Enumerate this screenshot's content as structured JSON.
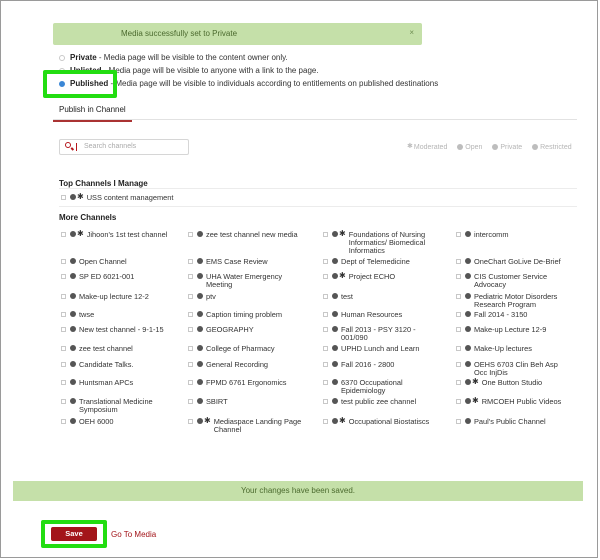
{
  "alert_top": {
    "message": "Media successfully set to Private",
    "close": "×"
  },
  "privacy": {
    "private": {
      "name": "Private",
      "desc": " - Media page will be visible to the content owner only."
    },
    "unlisted": {
      "name": "Unlisted",
      "desc": " - Media page will be visible to anyone with a link to the page."
    },
    "published": {
      "name": "Published",
      "desc": " - Media page will be visible to individuals according to entitlements on published destinations",
      "selected": true
    }
  },
  "tab": {
    "label": "Publish in Channel"
  },
  "search": {
    "placeholder": "Search channels"
  },
  "legend": {
    "moderated": "Moderated",
    "open": "Open",
    "private": "Private",
    "restricted": "Restricted"
  },
  "sections": {
    "top": "Top Channels I Manage",
    "more": "More Channels"
  },
  "top_channels": [
    {
      "label": "USS content management",
      "icons": [
        "globe",
        "star"
      ]
    }
  ],
  "channels": [
    {
      "label": "Jihoon's 1st test channel",
      "icons": [
        "globe",
        "star"
      ]
    },
    {
      "label": "zee test channel new media",
      "icons": [
        "globe"
      ]
    },
    {
      "label": "Foundations of Nursing\nInformatics/ Biomedical\nInformatics",
      "icons": [
        "globe",
        "star"
      ]
    },
    {
      "label": "intercomm",
      "icons": [
        "globe"
      ]
    },
    {
      "label": "Open Channel",
      "icons": [
        "globe"
      ]
    },
    {
      "label": "EMS Case Review",
      "icons": [
        "globe"
      ]
    },
    {
      "label": "Dept of Telemedicine",
      "icons": [
        "globe"
      ]
    },
    {
      "label": "OneChart GoLive De-Brief",
      "icons": [
        "globe"
      ]
    },
    {
      "label": "SP ED 6021-001",
      "icons": [
        "globe"
      ]
    },
    {
      "label": "UHA Water Emergency\nMeeting",
      "icons": [
        "globe"
      ]
    },
    {
      "label": "Project ECHO",
      "icons": [
        "globe",
        "star"
      ]
    },
    {
      "label": "CIS Customer Service\nAdvocacy",
      "icons": [
        "globe"
      ]
    },
    {
      "label": "Make-up lecture 12-2",
      "icons": [
        "globe"
      ]
    },
    {
      "label": "ptv",
      "icons": [
        "globe"
      ]
    },
    {
      "label": "test",
      "icons": [
        "globe"
      ]
    },
    {
      "label": "Pediatric Motor Disorders\nResearch Program",
      "icons": [
        "globe"
      ]
    },
    {
      "label": "twse",
      "icons": [
        "globe"
      ]
    },
    {
      "label": "Caption timing problem",
      "icons": [
        "globe"
      ]
    },
    {
      "label": "Human Resources",
      "icons": [
        "globe"
      ]
    },
    {
      "label": "Fall 2014 - 3150",
      "icons": [
        "globe"
      ]
    },
    {
      "label": "New test channel - 9-1-15",
      "icons": [
        "globe"
      ]
    },
    {
      "label": "GEOGRAPHY",
      "icons": [
        "globe"
      ]
    },
    {
      "label": "Fall 2013 - PSY 3120 -\n001/090",
      "icons": [
        "globe"
      ]
    },
    {
      "label": "Make-up Lecture 12-9",
      "icons": [
        "globe"
      ]
    },
    {
      "label": "zee test channel",
      "icons": [
        "globe"
      ]
    },
    {
      "label": "College of Pharmacy",
      "icons": [
        "globe"
      ]
    },
    {
      "label": "UPHD Lunch and Learn",
      "icons": [
        "globe"
      ]
    },
    {
      "label": "Make-Up lectures",
      "icons": [
        "globe"
      ]
    },
    {
      "label": "Candidate Talks.",
      "icons": [
        "globe"
      ]
    },
    {
      "label": "General Recording",
      "icons": [
        "globe"
      ]
    },
    {
      "label": "Fall 2016 - 2800",
      "icons": [
        "globe"
      ]
    },
    {
      "label": "OEHS 6703 Clin Beh Asp\nOcc InjDis",
      "icons": [
        "globe"
      ]
    },
    {
      "label": "Huntsman APCs",
      "icons": [
        "globe"
      ]
    },
    {
      "label": "FPMD 6761 Ergonomics",
      "icons": [
        "globe"
      ]
    },
    {
      "label": "6370 Occupational\nEpidemiology",
      "icons": [
        "globe"
      ]
    },
    {
      "label": "One Button Studio",
      "icons": [
        "globe",
        "star"
      ]
    },
    {
      "label": "Translational Medicine\nSymposium",
      "icons": [
        "globe"
      ]
    },
    {
      "label": "SBIRT",
      "icons": [
        "globe"
      ]
    },
    {
      "label": "test public zee channel",
      "icons": [
        "globe"
      ]
    },
    {
      "label": "RMCOEH Public Videos",
      "icons": [
        "globe",
        "star"
      ]
    },
    {
      "label": "OEH 6000",
      "icons": [
        "globe"
      ]
    },
    {
      "label": "Mediaspace Landing Page\nChannel",
      "icons": [
        "globe",
        "star"
      ]
    },
    {
      "label": "Occupational Biostatiscs",
      "icons": [
        "globe",
        "star"
      ]
    },
    {
      "label": "Paul's Public Channel",
      "icons": [
        "globe"
      ]
    }
  ],
  "alert_bottom": {
    "message": "Your changes have been saved."
  },
  "actions": {
    "save": "Save",
    "go_to_media": "Go To Media"
  },
  "colors": {
    "accent": "#a3151a",
    "success_bg": "#c5e0a9",
    "highlight": "#22dd11",
    "radio_selected": "#3b87d6"
  }
}
